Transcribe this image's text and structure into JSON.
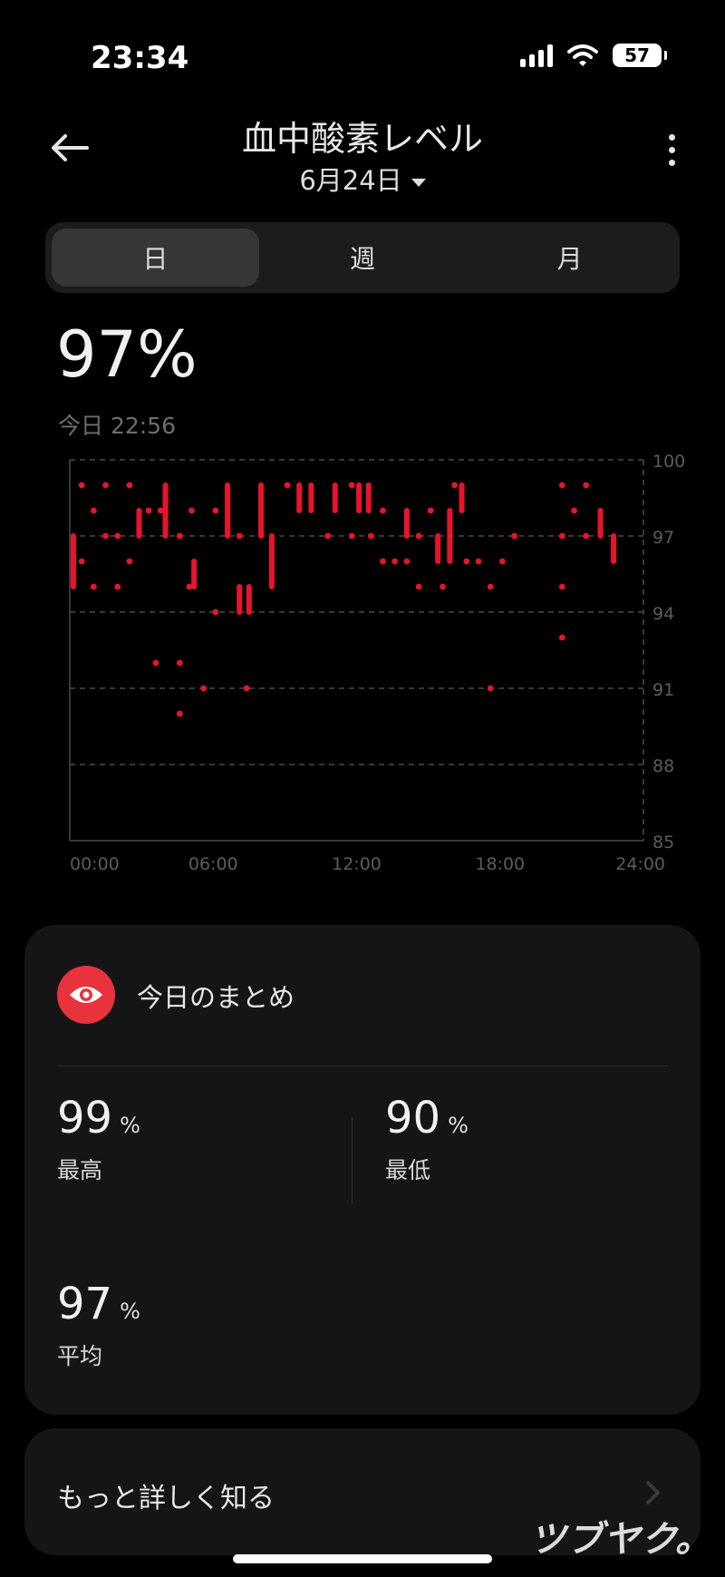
{
  "status_bar": {
    "time": "23:34",
    "battery": "57"
  },
  "header": {
    "title": "血中酸素レベル",
    "date": "6月24日"
  },
  "tabs": [
    {
      "label": "日",
      "active": true
    },
    {
      "label": "週",
      "active": false
    },
    {
      "label": "月",
      "active": false
    }
  ],
  "current": {
    "value": "97%",
    "timestamp": "今日 22:56"
  },
  "chart_data": {
    "type": "scatter",
    "x_unit": "hours",
    "xlim": [
      0,
      24
    ],
    "ylim": [
      85,
      100
    ],
    "x_ticks": [
      "00:00",
      "06:00",
      "12:00",
      "18:00",
      "24:00"
    ],
    "y_ticks": [
      "100",
      "97",
      "94",
      "91",
      "88",
      "85"
    ],
    "color": "#e8132d",
    "bars": [
      [
        0.15,
        95,
        97
      ],
      [
        2.9,
        97,
        98
      ],
      [
        4.0,
        97,
        99
      ],
      [
        5.2,
        95,
        96
      ],
      [
        6.6,
        97,
        99
      ],
      [
        7.1,
        94,
        95
      ],
      [
        7.5,
        94,
        95
      ],
      [
        8.0,
        97,
        99
      ],
      [
        8.45,
        95,
        97
      ],
      [
        9.6,
        98,
        99
      ],
      [
        10.1,
        98,
        99
      ],
      [
        11.1,
        98,
        99
      ],
      [
        12.1,
        98,
        99
      ],
      [
        12.5,
        98,
        99
      ],
      [
        14.1,
        97,
        98
      ],
      [
        15.4,
        96,
        97
      ],
      [
        15.9,
        96,
        98
      ],
      [
        16.4,
        98,
        99
      ],
      [
        22.2,
        97,
        98
      ],
      [
        22.75,
        96,
        97
      ]
    ],
    "points": [
      [
        0.5,
        99
      ],
      [
        0.5,
        96
      ],
      [
        1.0,
        98
      ],
      [
        1.0,
        95
      ],
      [
        1.5,
        99
      ],
      [
        1.5,
        97
      ],
      [
        2.0,
        97
      ],
      [
        2.0,
        95
      ],
      [
        2.5,
        99
      ],
      [
        2.5,
        96
      ],
      [
        3.3,
        98
      ],
      [
        3.8,
        98
      ],
      [
        3.6,
        92
      ],
      [
        4.6,
        92
      ],
      [
        4.6,
        90
      ],
      [
        4.6,
        97
      ],
      [
        5.0,
        95
      ],
      [
        5.1,
        98
      ],
      [
        5.6,
        91
      ],
      [
        6.1,
        94
      ],
      [
        6.1,
        98
      ],
      [
        7.1,
        97
      ],
      [
        7.4,
        91
      ],
      [
        9.1,
        99
      ],
      [
        10.8,
        97
      ],
      [
        11.8,
        97
      ],
      [
        11.8,
        99
      ],
      [
        12.6,
        97
      ],
      [
        13.1,
        96
      ],
      [
        13.1,
        98
      ],
      [
        13.6,
        96
      ],
      [
        14.1,
        96
      ],
      [
        14.6,
        97
      ],
      [
        14.6,
        95
      ],
      [
        15.1,
        98
      ],
      [
        15.6,
        95
      ],
      [
        16.1,
        99
      ],
      [
        16.6,
        96
      ],
      [
        17.1,
        96
      ],
      [
        17.6,
        95
      ],
      [
        17.6,
        91
      ],
      [
        18.1,
        96
      ],
      [
        18.6,
        97
      ],
      [
        20.6,
        99
      ],
      [
        20.6,
        97
      ],
      [
        20.6,
        95
      ],
      [
        20.6,
        93
      ],
      [
        21.1,
        98
      ],
      [
        21.6,
        99
      ],
      [
        21.6,
        97
      ]
    ]
  },
  "summary": {
    "title": "今日のまとめ",
    "max": {
      "value": "99",
      "unit": "%",
      "label": "最高"
    },
    "min": {
      "value": "90",
      "unit": "%",
      "label": "最低"
    },
    "avg": {
      "value": "97",
      "unit": "%",
      "label": "平均"
    }
  },
  "learn_more": {
    "label": "もっと詳しく知る"
  },
  "watermark": "ツブヤク。"
}
